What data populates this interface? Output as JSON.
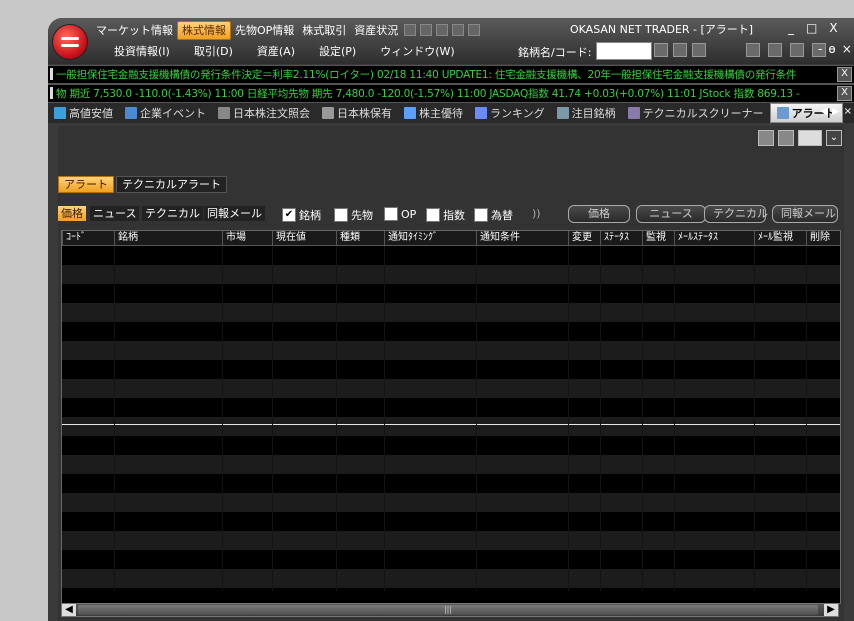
{
  "menu_top": {
    "items": [
      "マーケット情報",
      "株式情報",
      "先物OP情報",
      "株式取引",
      "資産状況"
    ],
    "active": "株式情報"
  },
  "app_title": "OKASAN NET TRADER - [アラート]",
  "window_controls": [
    "_",
    "□",
    "X"
  ],
  "menu_second": [
    "投資情報(I)",
    "取引(D)",
    "資産(A)",
    "設定(P)",
    "ウィンドウ(W)"
  ],
  "code_search": {
    "label": "銘柄名/コード:",
    "value": ""
  },
  "mdi_controls": [
    "-",
    "ɵ",
    "×"
  ],
  "ticker1": {
    "text": "一般担保住宅金融支援機構債の発行条件決定＝利率2.11%(ロイター) 02/18 11:40  UPDATE1: 住宅金融支援機構、20年一般担保住宅金融支援機構債の発行条件",
    "close": "X"
  },
  "ticker2": {
    "text": "物 期近 7,530.0  -110.0(-1.43%)  11:00     日経平均先物 期先 7,480.0  -120.0(-1.57%)  11:00     JASDAQ指数 41.74  +0.03(+0.07%)  11:01     JStock 指数 869.13  -",
    "close": "X"
  },
  "tabs": [
    {
      "label": "高値安値",
      "color": "#3aa0e0"
    },
    {
      "label": "企業イベント",
      "color": "#4a8ad0"
    },
    {
      "label": "日本株注文照会",
      "color": "#888888"
    },
    {
      "label": "日本株保有",
      "color": "#999999"
    },
    {
      "label": "株主優待",
      "color": "#5aa0ff"
    },
    {
      "label": "ランキング",
      "color": "#6a8aff"
    },
    {
      "label": "注目銘柄",
      "color": "#7a9aaa"
    },
    {
      "label": "テクニカルスクリーナー",
      "color": "#8a7aaa"
    },
    {
      "label": "アラート",
      "color": "#6a9ad0"
    }
  ],
  "active_tab": "アラート",
  "tab_nav": [
    "◀",
    "▶",
    "×"
  ],
  "subtabs": [
    "アラート",
    "テクニカルアラート"
  ],
  "active_subtab": "アラート",
  "filter_tabs": [
    "価格",
    "ニュース",
    "テクニカル",
    "同報メール"
  ],
  "active_filter": "価格",
  "checkboxes": [
    {
      "label": "銘柄",
      "checked": true
    },
    {
      "label": "先物",
      "checked": false
    },
    {
      "label": "OP",
      "checked": false
    },
    {
      "label": "指数",
      "checked": false
    },
    {
      "label": "為替",
      "checked": false
    }
  ],
  "misc_mark": "))",
  "action_buttons": [
    "価格",
    "ニュース",
    "テクニカル",
    "同報メール"
  ],
  "columns": [
    "ｺｰﾄﾞ",
    "銘柄",
    "市場",
    "現在値",
    "種類",
    "通知ﾀｲﾐﾝｸﾞ",
    "通知条件",
    "変更",
    "ｽﾃｰﾀｽ",
    "監視",
    "ﾒｰﾙｽﾃｰﾀｽ",
    "ﾒｰﾙ監視",
    "削除"
  ],
  "scroll": {
    "left": "◀",
    "right": "▶",
    "thumb": "|||"
  }
}
